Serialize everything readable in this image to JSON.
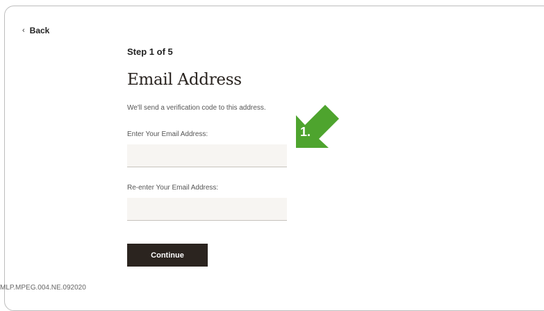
{
  "nav": {
    "back_label": "Back"
  },
  "form": {
    "step": "Step 1 of 5",
    "title": "Email Address",
    "subtitle": "We'll send a verification code to this address.",
    "email_label": "Enter Your Email Address:",
    "email_value": "",
    "confirm_label": "Re-enter Your Email Address:",
    "confirm_value": "",
    "continue_label": "Continue"
  },
  "annotation": {
    "label": "1.",
    "color": "#4ea42e"
  },
  "footer": {
    "code": "MLP.MPEG.004.NE.092020"
  },
  "icons": {
    "back": "chevron-left-icon",
    "annotation": "arrow-icon"
  }
}
